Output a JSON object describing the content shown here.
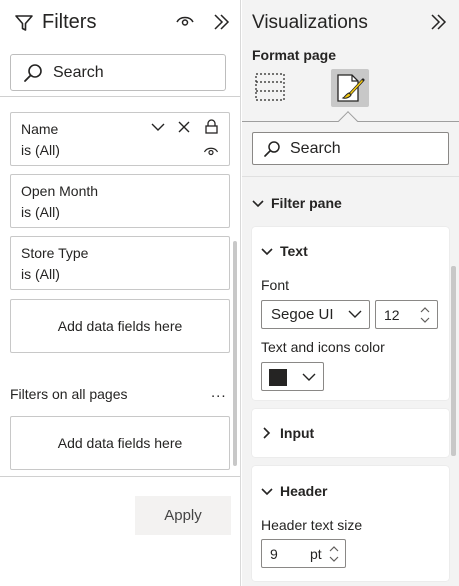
{
  "filters_pane": {
    "title": "Filters",
    "icons": {
      "title": "filter-funnel-icon",
      "visibility": "eye-icon",
      "collapse": "double-chevron-right-icon"
    },
    "search_placeholder": "Search",
    "page_filters": [
      {
        "name": "Name",
        "state": "is (All)"
      },
      {
        "name": "Open Month",
        "state": "is (All)"
      },
      {
        "name": "Store Type",
        "state": "is (All)"
      }
    ],
    "add_fields_page": "Add data fields here",
    "all_pages_label": "Filters on all pages",
    "more_options": "...",
    "add_fields_all": "Add data fields here",
    "apply_label": "Apply"
  },
  "viz_pane": {
    "title": "Visualizations",
    "subtitle": "Format page",
    "tabs": [
      "field-list-icon",
      "format-paintbrush-icon"
    ],
    "active_tab": "format-paintbrush-icon",
    "search_placeholder": "Search",
    "sections": {
      "filter_pane": "Filter pane",
      "text": "Text",
      "input": "Input",
      "header": "Header"
    },
    "text_card": {
      "font_label": "Font",
      "font_value": "Segoe UI",
      "font_size": "12",
      "color_label": "Text and icons color",
      "color_value": "#252423"
    },
    "header_card": {
      "size_label": "Header text size",
      "size_value": "9",
      "size_unit": "pt"
    }
  },
  "colors": {
    "text": "#252423",
    "filters_bg": "#ffffff",
    "viz_bg": "#f3f3f3",
    "active_tab_bg": "#c8c8c8",
    "accent_yellow": "#f2c811"
  }
}
